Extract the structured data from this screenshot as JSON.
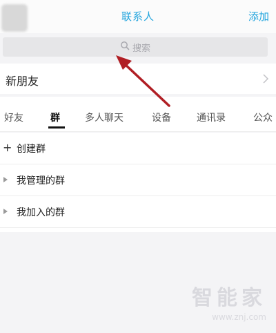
{
  "header": {
    "title": "联系人",
    "add_label": "添加"
  },
  "search": {
    "placeholder": "搜索"
  },
  "new_friends": {
    "label": "新朋友"
  },
  "tabs": [
    {
      "label": "好友"
    },
    {
      "label": "群",
      "active": true
    },
    {
      "label": "多人聊天"
    },
    {
      "label": "设备"
    },
    {
      "label": "通讯录"
    },
    {
      "label": "公众"
    }
  ],
  "groups": {
    "create_label": "创建群",
    "items": [
      {
        "label": "我管理的群"
      },
      {
        "label": "我加入的群"
      }
    ]
  },
  "watermark": {
    "name": "智能家",
    "url": "www.znj.com"
  },
  "colors": {
    "accent": "#21a4dd",
    "annotation_arrow": "#b01e24"
  },
  "icons": {
    "search": "search-icon",
    "chevron": "chevron-right-icon",
    "add": "plus-icon",
    "expand": "triangle-right-icon"
  }
}
